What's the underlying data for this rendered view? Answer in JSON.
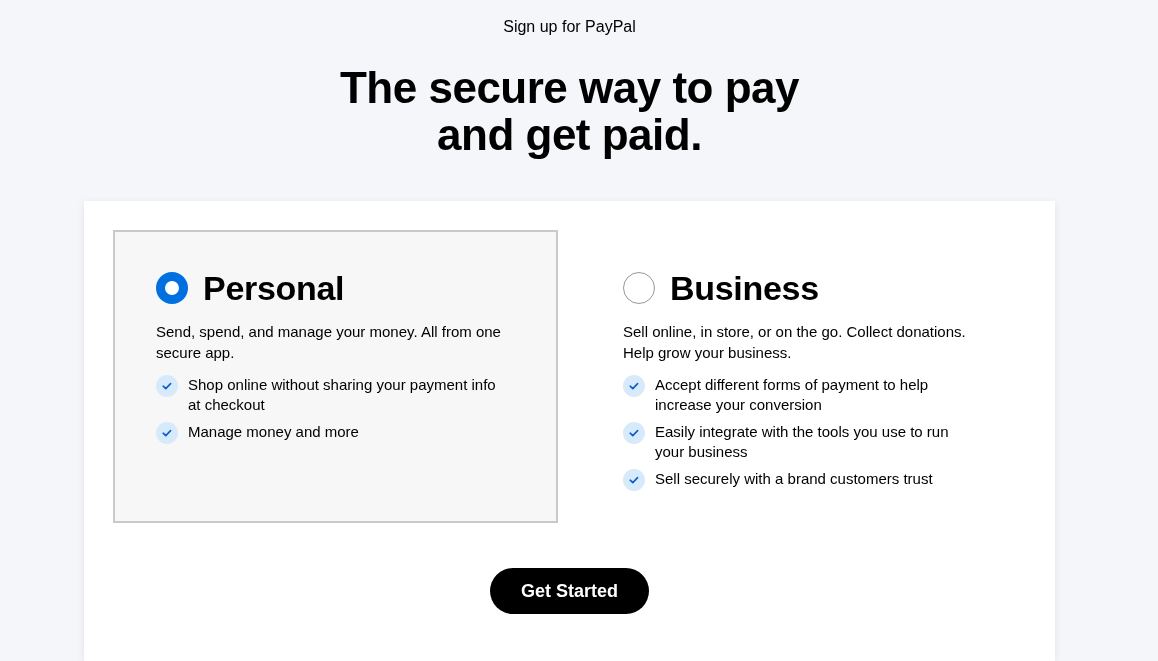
{
  "header": {
    "title": "Sign up for PayPal",
    "headline_lines": [
      "The secure way to pay",
      "and get paid."
    ]
  },
  "account_types": [
    {
      "name": "Personal",
      "selected": true,
      "description": "Send, spend, and manage your money. All from one secure app.",
      "features": [
        "Shop online without sharing your payment info at checkout",
        "Manage money and more"
      ]
    },
    {
      "name": "Business",
      "selected": false,
      "description": "Sell online, in store, or on the go. Collect donations. Help grow your business.",
      "features": [
        "Accept different forms of payment to help increase your conversion",
        "Easily integrate with the tools you use to run your business",
        "Sell securely with a brand customers trust"
      ]
    }
  ],
  "button": {
    "label": "Get Started"
  }
}
